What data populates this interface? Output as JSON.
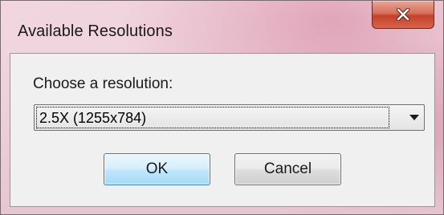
{
  "window": {
    "title": "Available Resolutions",
    "close_icon": "close-icon",
    "close_color": "#c4412a"
  },
  "dialog": {
    "prompt": "Choose a resolution:",
    "resolution_select": {
      "selected": "2.5X (1255x784)",
      "arrow_icon": "chevron-down-icon"
    },
    "buttons": {
      "ok": "OK",
      "cancel": "Cancel"
    }
  },
  "colors": {
    "ok_border": "#3c7fb1",
    "client_bg": "#f0f0f0"
  }
}
